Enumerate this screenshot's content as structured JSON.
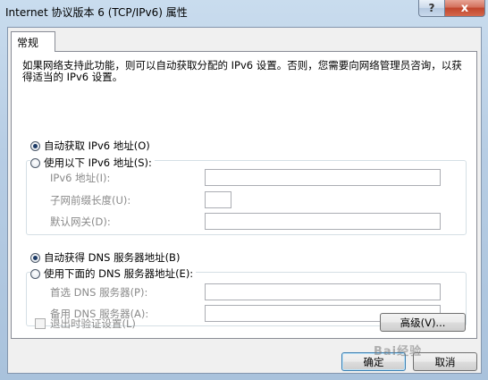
{
  "window": {
    "title": "Internet 协议版本 6 (TCP/IPv6) 属性",
    "help_glyph": "?",
    "close_glyph": "x"
  },
  "tab": {
    "label": "常规"
  },
  "description": "如果网络支持此功能，则可以自动获取分配的 IPv6 设置。否则，您需要向网络管理员咨询，以获得适当的 IPv6 设置。",
  "ip_section": {
    "auto_option": "自动获取 IPv6 地址(O)",
    "auto_selected": true,
    "manual_option": "使用以下 IPv6 地址(S):",
    "fields": [
      {
        "label": "IPv6 地址(I):",
        "value": ""
      },
      {
        "label": "子网前缀长度(U):",
        "value": ""
      },
      {
        "label": "默认网关(D):",
        "value": ""
      }
    ]
  },
  "dns_section": {
    "auto_option": "自动获得 DNS 服务器地址(B)",
    "auto_selected": true,
    "manual_option": "使用下面的 DNS 服务器地址(E):",
    "fields": [
      {
        "label": "首选 DNS 服务器(P):",
        "value": ""
      },
      {
        "label": "备用 DNS 服务器(A):",
        "value": ""
      }
    ]
  },
  "validate_checkbox": {
    "label": "退出时验证设置(L)",
    "checked": false
  },
  "buttons": {
    "advanced": "高级(V)...",
    "ok": "确定",
    "cancel": "取消"
  },
  "watermark": "Bai经验"
}
